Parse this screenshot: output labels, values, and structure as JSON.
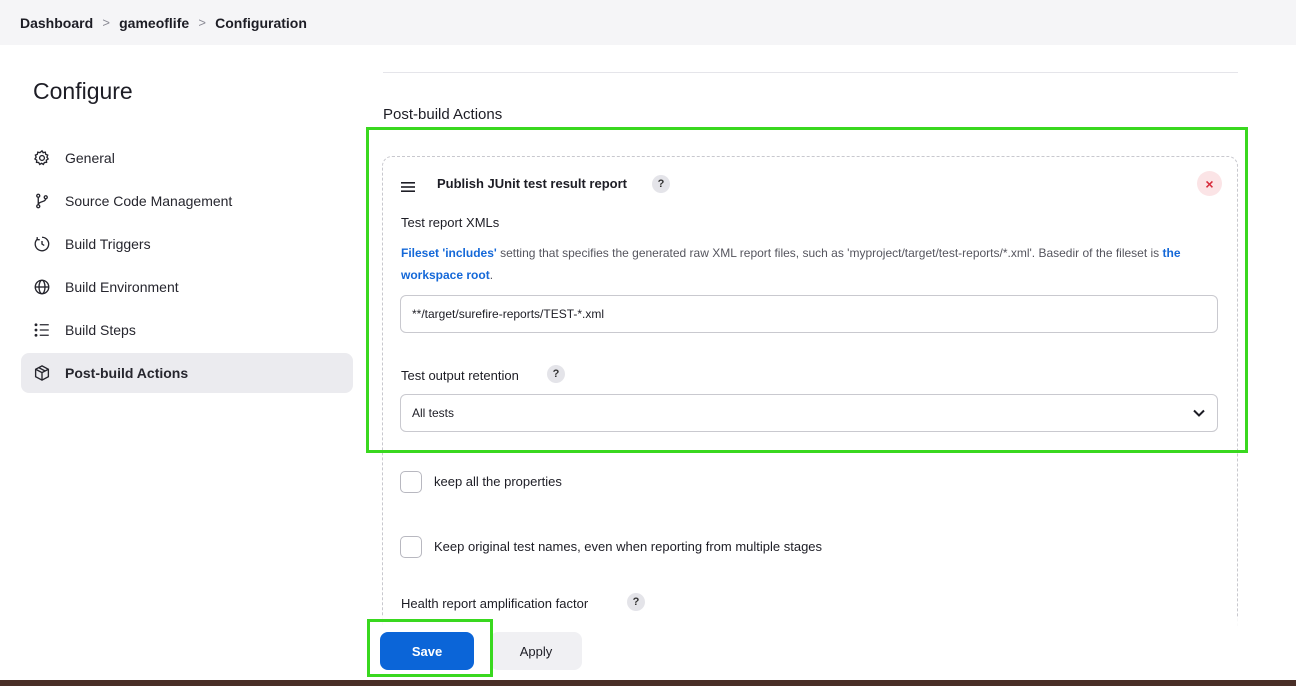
{
  "breadcrumb": {
    "items": [
      "Dashboard",
      "gameoflife",
      "Configuration"
    ],
    "separator": ">"
  },
  "page_title": "Configure",
  "sidebar": {
    "items": [
      {
        "label": "General",
        "icon": "gear-icon"
      },
      {
        "label": "Source Code Management",
        "icon": "branch-icon"
      },
      {
        "label": "Build Triggers",
        "icon": "timer-icon"
      },
      {
        "label": "Build Environment",
        "icon": "globe-icon"
      },
      {
        "label": "Build Steps",
        "icon": "list-icon"
      },
      {
        "label": "Post-build Actions",
        "icon": "package-icon",
        "active": true
      }
    ]
  },
  "main": {
    "section_title": "Post-build Actions",
    "plugin": {
      "title": "Publish JUnit test result report",
      "help_glyph": "?",
      "delete_glyph": "×",
      "test_report_xmls": {
        "label": "Test report XMLs",
        "desc_link1": "Fileset 'includes'",
        "desc_text1": " setting that specifies the generated raw XML report files, such as 'myproject/target/test-reports/*.xml'. Basedir of the fileset is ",
        "desc_link2": "the workspace root",
        "desc_text2": ".",
        "value": "**/target/surefire-reports/TEST-*.xml"
      },
      "test_output_retention": {
        "label": "Test output retention",
        "selected": "All tests"
      },
      "keep_properties": {
        "label": "keep all the properties",
        "checked": false
      },
      "keep_names": {
        "label": "Keep original test names, even when reporting from multiple stages",
        "checked": false
      },
      "health_factor": {
        "label": "Health report amplification factor"
      }
    }
  },
  "actions": {
    "save": "Save",
    "apply": "Apply"
  },
  "colors": {
    "primary": "#0b65d8",
    "highlight": "#39d81f",
    "delete": "#d72c3c",
    "link": "#1468d8"
  }
}
